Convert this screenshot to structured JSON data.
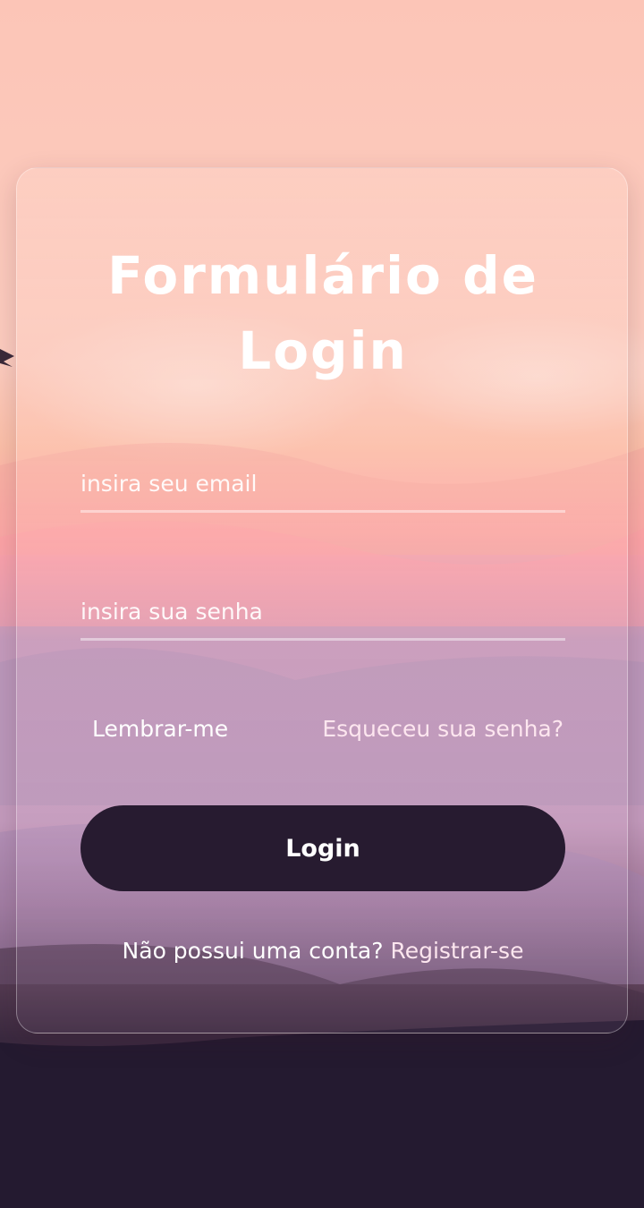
{
  "form": {
    "title": "Formulário de Login",
    "email": {
      "placeholder": "insira seu email",
      "value": ""
    },
    "password": {
      "placeholder": "insira sua senha",
      "value": ""
    },
    "remember_label": "Lembrar-me",
    "forgot_link": "Esqueceu sua senha?",
    "login_button": "Login",
    "register_prompt": "Não possui uma conta?",
    "register_link": "Registrar-se"
  },
  "colors": {
    "sky_top": "#fcc6b8",
    "pink_band": "#ffa6ab",
    "purple_band": "#c49bbc",
    "dark_ground": "#241a30",
    "button": "#271b30",
    "link": "#fde6ef"
  }
}
